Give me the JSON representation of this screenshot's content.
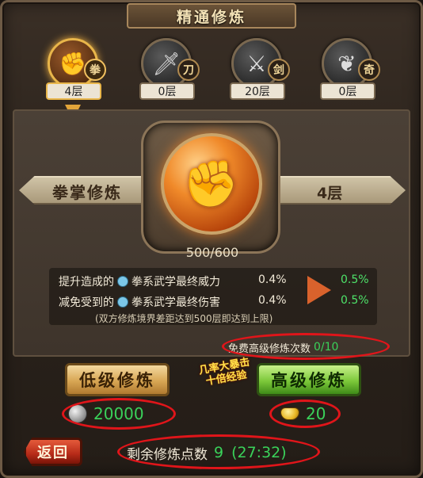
{
  "window": {
    "title": "精通修炼"
  },
  "tabs": [
    {
      "icon": "fist-icon",
      "badge": "拳",
      "level": "4层",
      "active": true
    },
    {
      "icon": "blade-icon",
      "badge": "刀",
      "level": "0层",
      "active": false
    },
    {
      "icon": "sword-icon",
      "badge": "剑",
      "level": "20层",
      "active": false
    },
    {
      "icon": "fan-icon",
      "badge": "奇",
      "level": "0层",
      "active": false
    }
  ],
  "main": {
    "skill_name": "拳掌修炼",
    "skill_level": "4层",
    "progress_text": "500/600",
    "progress": {
      "current": 500,
      "max": 600
    },
    "stats": [
      {
        "prefix": "提升造成的",
        "name": "拳系武学最终威力",
        "current": "0.4%",
        "next": "0.5%"
      },
      {
        "prefix": "减免受到的",
        "name": "拳系武学最终伤害",
        "current": "0.4%",
        "next": "0.5%"
      }
    ],
    "note": "(双方修炼境界差距达到500层即达到上限)"
  },
  "free_upgrade": {
    "label": "免费高级修炼次数",
    "value": "0/10"
  },
  "buttons": {
    "low_label": "低级修炼",
    "high_label": "高级修炼"
  },
  "promo": {
    "line1": "几率大暴击",
    "line2": "十倍经验"
  },
  "costs": {
    "low": "20000",
    "high": "20"
  },
  "footer": {
    "back_label": "返回",
    "remaining_label": "剩余修炼点数",
    "remaining_points": "9",
    "timer": "(27:32)"
  },
  "colors": {
    "accent_gold": "#e9b64a",
    "value_green": "#3ad25a",
    "annotation_red": "#e0151a"
  }
}
